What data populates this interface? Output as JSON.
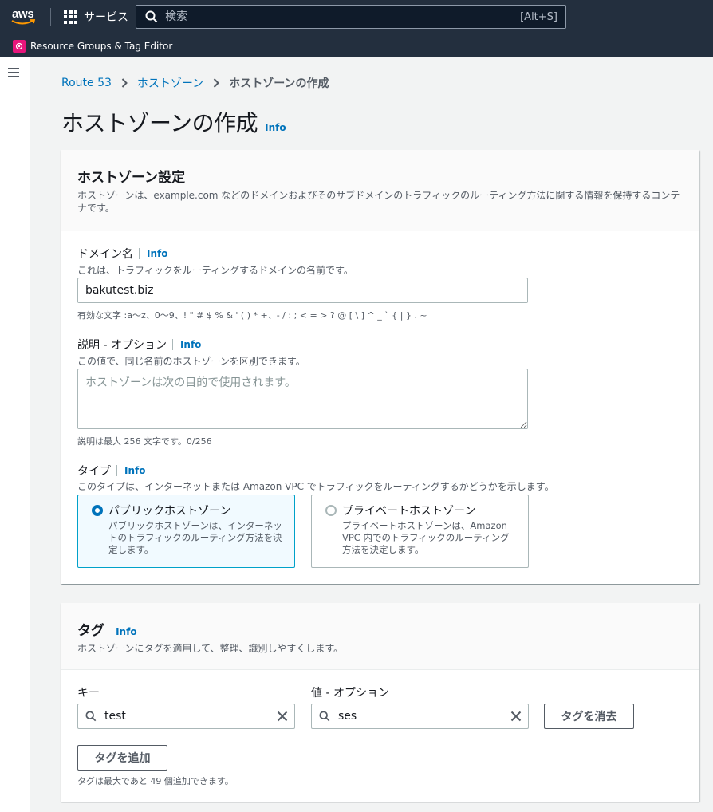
{
  "topnav": {
    "logo_text": "aws",
    "services_label": "サービス",
    "search_placeholder": "検索",
    "search_shortcut": "[Alt+S]"
  },
  "subnav": {
    "resource_groups_label": "Resource Groups & Tag Editor"
  },
  "breadcrumb": {
    "items": [
      "Route 53",
      "ホストゾーン"
    ],
    "current": "ホストゾーンの作成"
  },
  "page": {
    "title": "ホストゾーンの作成",
    "info": "Info"
  },
  "hosted_zone_settings": {
    "title": "ホストゾーン設定",
    "description": "ホストゾーンは、example.com などのドメインおよびそのサブドメインのトラフィックのルーティング方法に関する情報を保持するコンテナです。",
    "domain": {
      "label": "ドメイン名",
      "info": "Info",
      "description": "これは、トラフィックをルーティングするドメインの名前です。",
      "value": "bakutest.biz",
      "hint": "有効な文字 :a〜z、0〜9、! \" # $ % & ' ( ) * +、- / : ; < = > ? @ [ \\ ] ^ _ ` { | } . ~"
    },
    "description_field": {
      "label": "説明 - オプション",
      "info": "Info",
      "description": "この値で、同じ名前のホストゾーンを区別できます。",
      "placeholder": "ホストゾーンは次の目的で使用されます。",
      "hint": "説明は最大 256 文字です。0/256"
    },
    "type": {
      "label": "タイプ",
      "info": "Info",
      "description": "このタイプは、インターネットまたは Amazon VPC でトラフィックをルーティングするかどうかを示します。",
      "options": [
        {
          "title": "パブリックホストゾーン",
          "description": "パブリックホストゾーンは、インターネットのトラフィックのルーティング方法を決定します。",
          "selected": true
        },
        {
          "title": "プライベートホストゾーン",
          "description": "プライベートホストゾーンは、Amazon VPC 内でのトラフィックのルーティング方法を決定します。",
          "selected": false
        }
      ]
    }
  },
  "tags": {
    "title": "タグ",
    "info": "Info",
    "description": "ホストゾーンにタグを適用して、整理、識別しやすくします。",
    "key_label": "キー",
    "value_label": "値 - オプション",
    "key_value": "test",
    "value_value": "ses",
    "remove_button": "タグを消去",
    "add_button": "タグを追加",
    "limit_hint": "タグは最大であと 49 個追加できます。"
  },
  "colors": {
    "nav_bg": "#232f3e",
    "link": "#0073bb",
    "selected_border": "#00a1c9",
    "resource_groups_icon": "#e7157b"
  }
}
